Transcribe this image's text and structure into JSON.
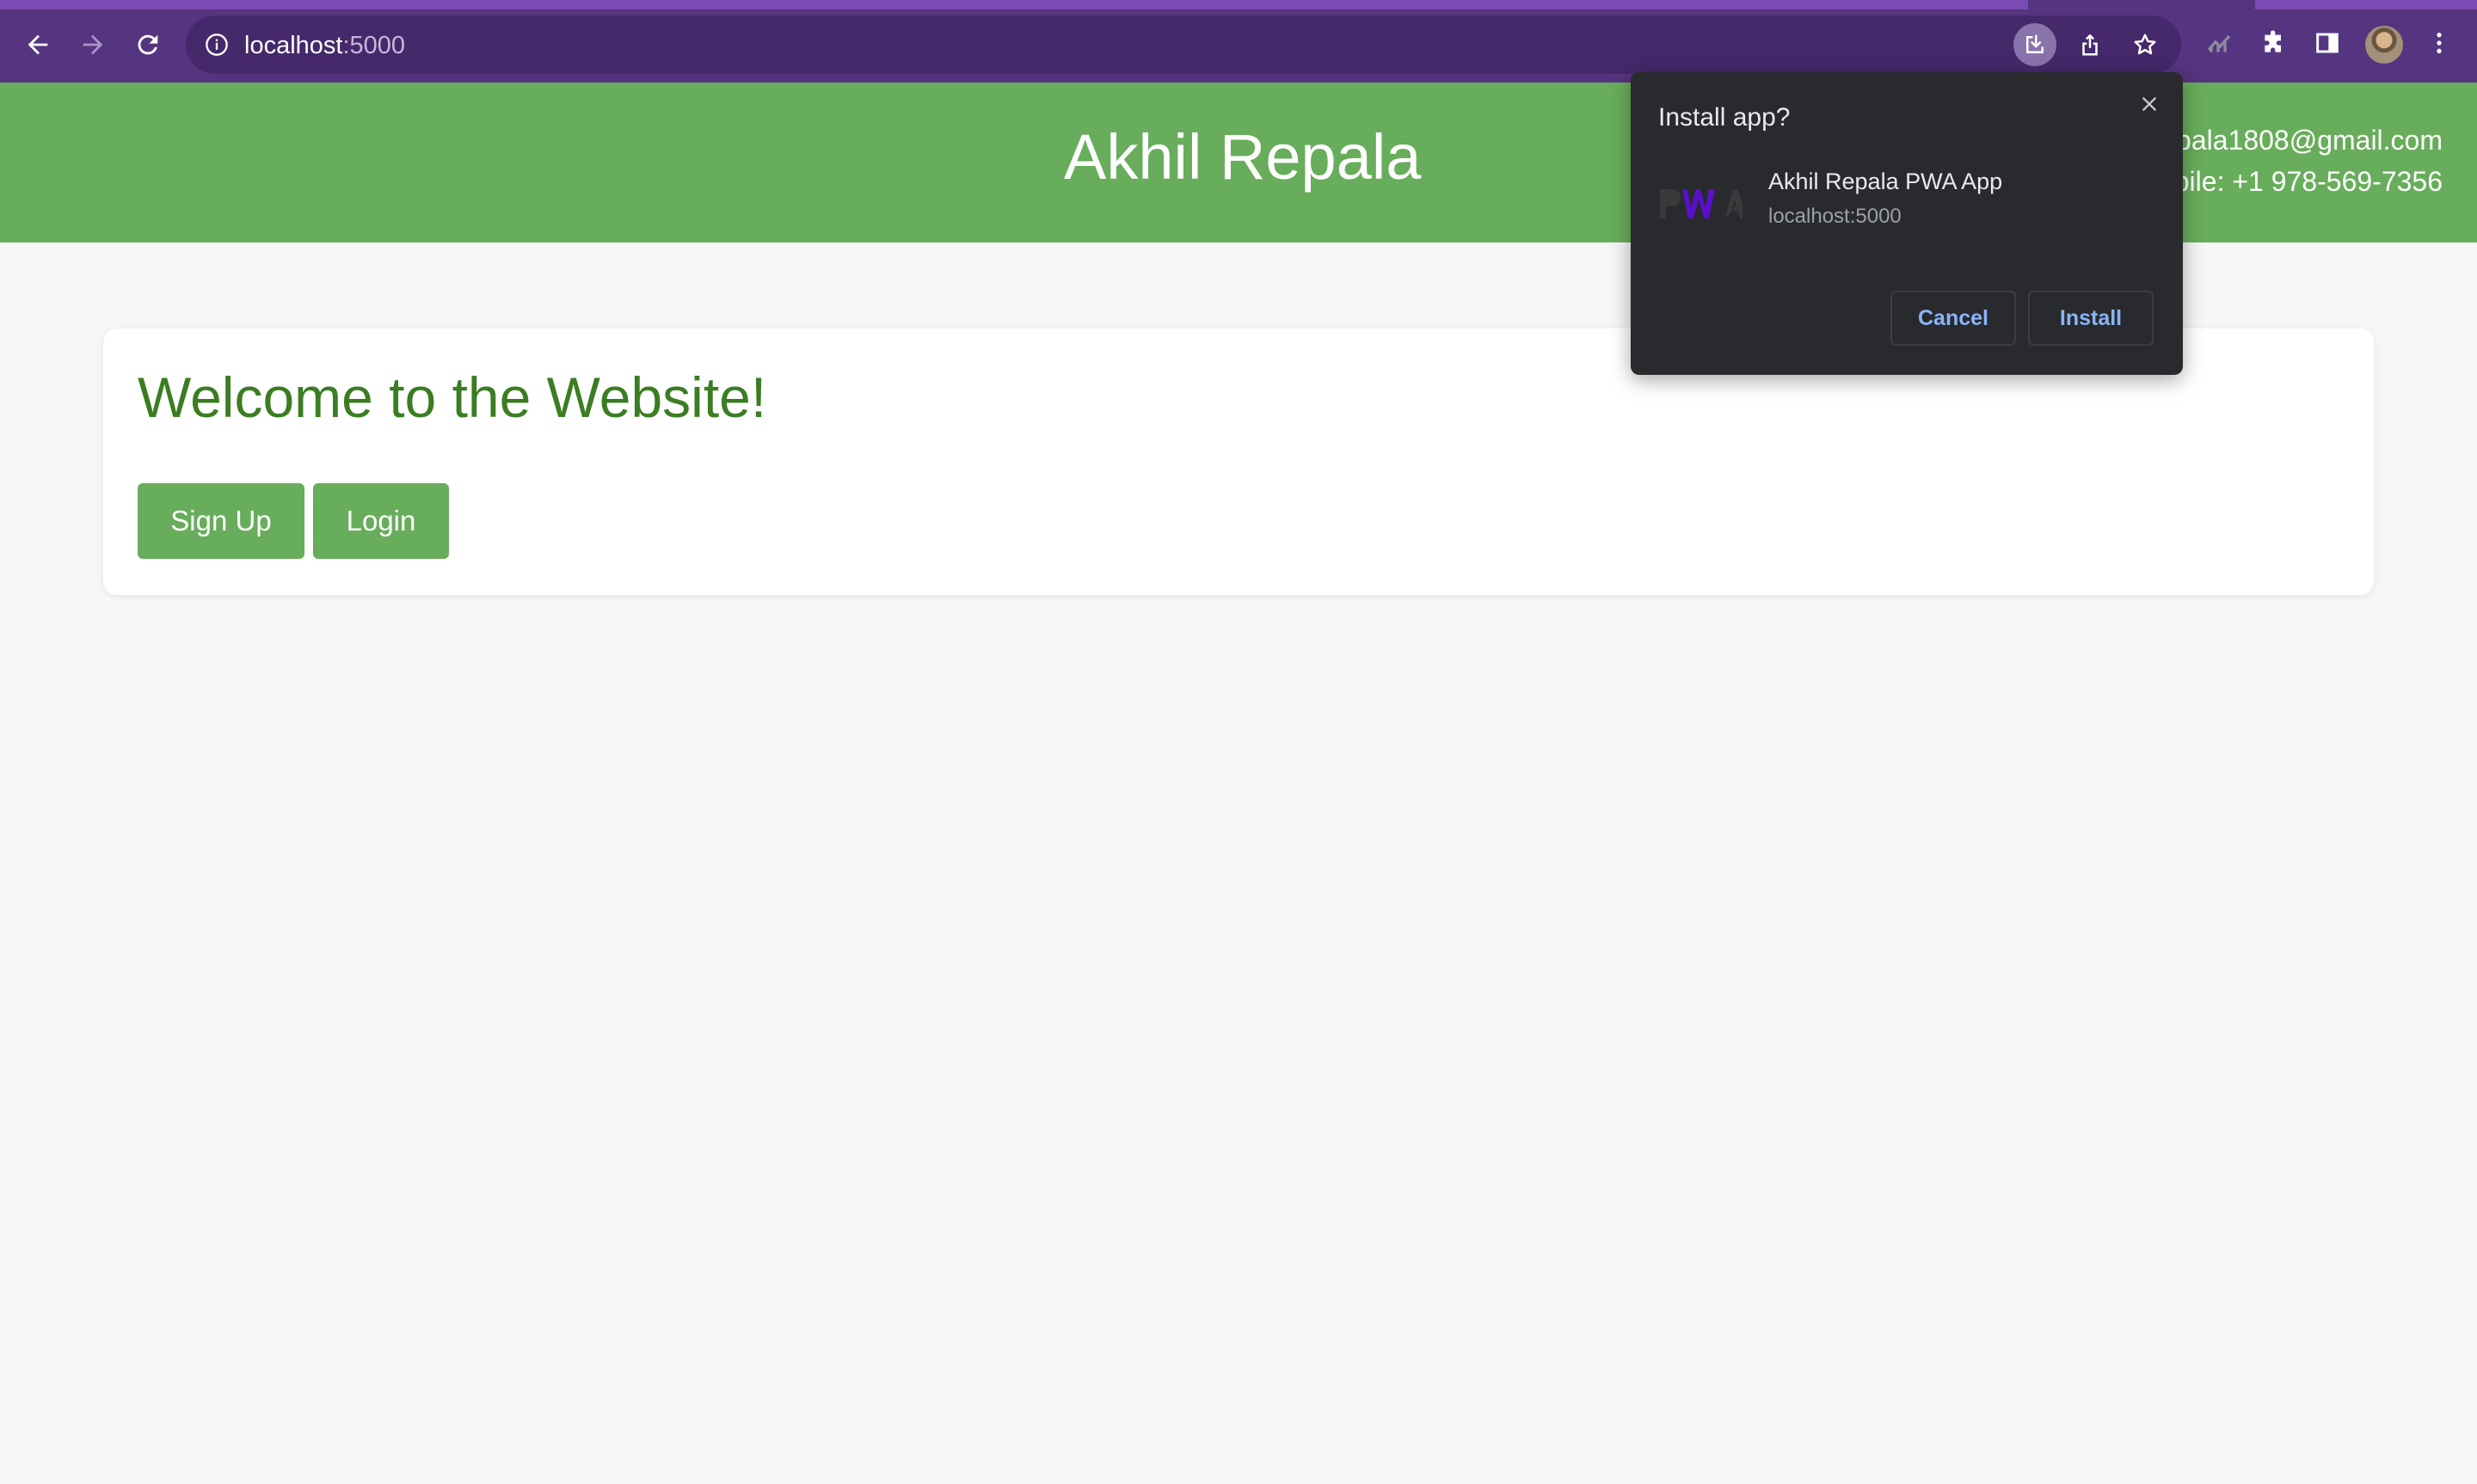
{
  "browser": {
    "url_host": "localhost",
    "url_port": ":5000",
    "icons": {
      "back": "arrow-left-icon",
      "forward": "arrow-right-icon",
      "reload": "reload-icon",
      "site_info": "info-icon",
      "install": "install-app-icon",
      "share": "share-icon",
      "bookmark": "star-icon",
      "extension_chart": "chart-extension-icon",
      "extensions": "puzzle-icon",
      "side_panel": "side-panel-icon",
      "menu": "kebab-menu-icon"
    },
    "colors": {
      "toolbar": "#55357f",
      "omnibox": "#45296b"
    }
  },
  "header": {
    "title": "Akhil Repala",
    "email": "pala1808@gmail.com",
    "mobile": "bile: +1 978-569-7356",
    "color": "#68ad5b"
  },
  "main": {
    "welcome": "Welcome to the Website!",
    "signup_label": "Sign Up",
    "login_label": "Login",
    "heading_color": "#3b7d22"
  },
  "install_dialog": {
    "title": "Install app?",
    "app_name": "Akhil Repala PWA App",
    "origin": "localhost:5000",
    "logo_text": "PWA",
    "cancel_label": "Cancel",
    "install_label": "Install",
    "background": "#292a2d",
    "accent": "#8ab4f8"
  }
}
